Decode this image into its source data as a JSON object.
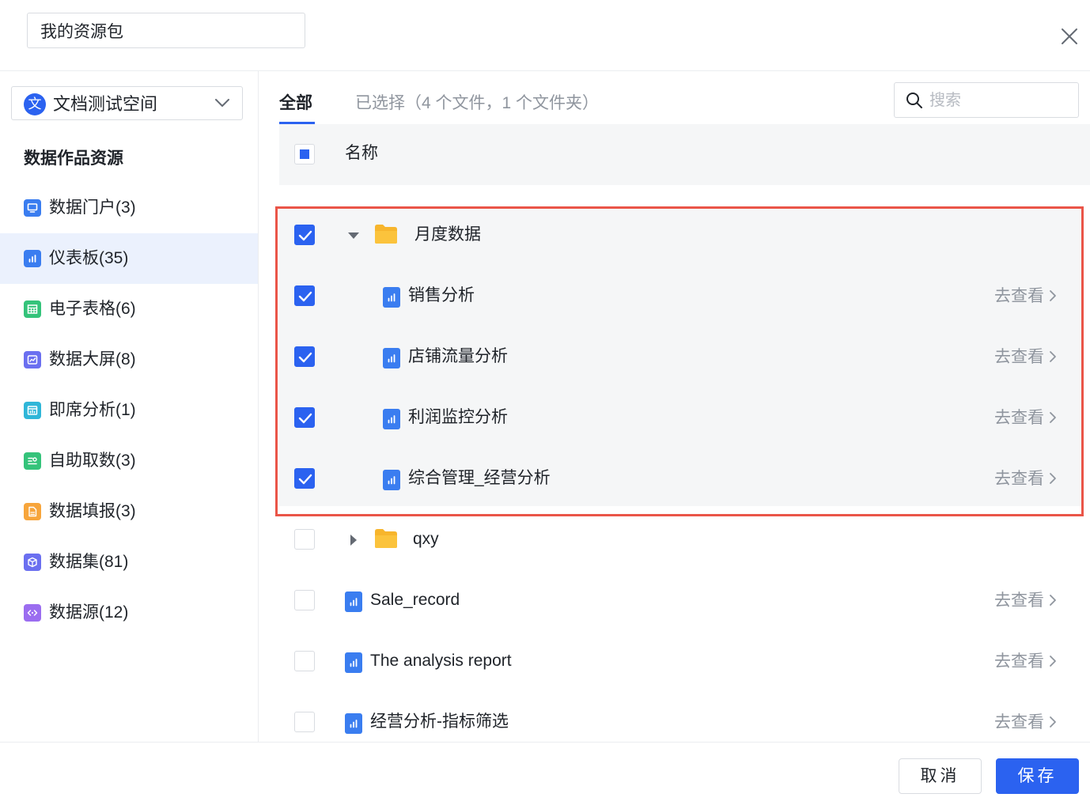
{
  "header": {
    "package_name": "我的资源包"
  },
  "sidebar": {
    "space_avatar": "文",
    "space_name": "文档测试空间",
    "section_title": "数据作品资源",
    "items": [
      {
        "label": "数据门户(3)",
        "icon": "portal-icon",
        "color": "#3a7df0"
      },
      {
        "label": "仪表板(35)",
        "icon": "dashboard-icon",
        "color": "#3a7df0"
      },
      {
        "label": "电子表格(6)",
        "icon": "spreadsheet-icon",
        "color": "#34c37a"
      },
      {
        "label": "数据大屏(8)",
        "icon": "screen-icon",
        "color": "#6b6ff0"
      },
      {
        "label": "即席分析(1)",
        "icon": "adhoc-analysis-icon",
        "color": "#2fb6d8"
      },
      {
        "label": "自助取数(3)",
        "icon": "self-service-icon",
        "color": "#34c37a"
      },
      {
        "label": "数据填报(3)",
        "icon": "data-report-icon",
        "color": "#f7a53b"
      },
      {
        "label": "数据集(81)",
        "icon": "dataset-icon",
        "color": "#6b6ff0"
      },
      {
        "label": "数据源(12)",
        "icon": "datasource-icon",
        "color": "#9b6df0"
      }
    ]
  },
  "main": {
    "tab_all": "全部",
    "tab_selected": "已选择（4 个文件，1 个文件夹）",
    "search_placeholder": "搜索",
    "column_name": "名称",
    "view_label": "去查看",
    "rows": [
      {
        "label": "月度数据",
        "type": "folder",
        "expanded": true,
        "checked": true
      },
      {
        "label": "销售分析",
        "type": "dashboard",
        "checked": true
      },
      {
        "label": "店铺流量分析",
        "type": "dashboard",
        "checked": true
      },
      {
        "label": "利润监控分析",
        "type": "dashboard",
        "checked": true
      },
      {
        "label": "综合管理_经营分析",
        "type": "dashboard",
        "checked": true
      },
      {
        "label": "qxy",
        "type": "folder",
        "expanded": false,
        "checked": false
      },
      {
        "label": "Sale_record",
        "type": "dashboard",
        "checked": false
      },
      {
        "label": "The analysis report",
        "type": "dashboard",
        "checked": false
      },
      {
        "label": "经营分析-指标筛选",
        "type": "dashboard",
        "checked": false
      }
    ]
  },
  "footer": {
    "cancel_label": "取消",
    "save_label": "保存"
  },
  "colors": {
    "accent": "#2b62f0",
    "highlight_border": "#ea5548",
    "folder": "#f7b52c"
  }
}
